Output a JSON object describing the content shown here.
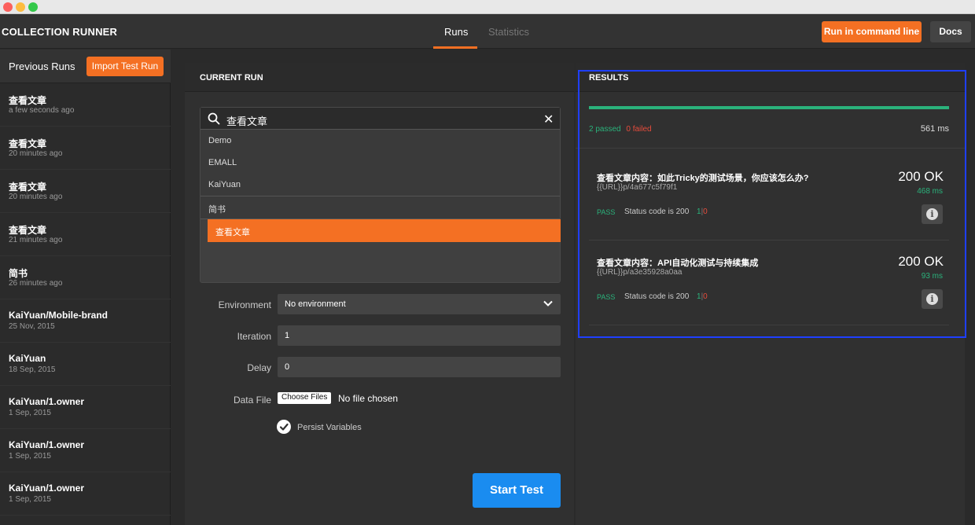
{
  "header": {
    "app_title": "COLLECTION RUNNER",
    "tabs": [
      {
        "label": "Runs"
      },
      {
        "label": "Statistics"
      }
    ],
    "run_cmd_label": "Run in command line",
    "docs_label": "Docs"
  },
  "sidebar": {
    "title": "Previous Runs",
    "import_label": "Import Test Run",
    "runs": [
      {
        "name": "查看文章",
        "time": "a few seconds ago"
      },
      {
        "name": "查看文章",
        "time": "20 minutes ago"
      },
      {
        "name": "查看文章",
        "time": "20 minutes ago"
      },
      {
        "name": "查看文章",
        "time": "21 minutes ago"
      },
      {
        "name": "简书",
        "time": "26 minutes ago"
      },
      {
        "name": "KaiYuan/Mobile-brand",
        "time": "25 Nov, 2015"
      },
      {
        "name": "KaiYuan",
        "time": "18 Sep, 2015"
      },
      {
        "name": "KaiYuan/1.owner",
        "time": "1 Sep, 2015"
      },
      {
        "name": "KaiYuan/1.owner",
        "time": "1 Sep, 2015"
      },
      {
        "name": "KaiYuan/1.owner",
        "time": "1 Sep, 2015"
      }
    ]
  },
  "current_run": {
    "title": "CURRENT RUN",
    "search_value": "查看文章",
    "options": [
      "Demo",
      "EMALL",
      "KaiYuan",
      "简书",
      "查看文章"
    ],
    "environment_label": "Environment",
    "environment_value": "No environment",
    "iteration_label": "Iteration",
    "iteration_value": "1",
    "delay_label": "Delay",
    "delay_value": "0",
    "datafile_label": "Data File",
    "choose_files_label": "Choose Files",
    "no_file_label": "No file chosen",
    "persist_label": "Persist Variables",
    "start_label": "Start Test"
  },
  "results": {
    "title": "RESULTS",
    "passed": "2 passed",
    "failed": "0 failed",
    "duration": "561 ms",
    "items": [
      {
        "title": "查看文章内容：如此Tricky的测试场景，你应该怎么办?",
        "url": "{{URL}}p/4a677c5f79f1",
        "status": "200 OK",
        "ms": "468 ms",
        "pass_label": "PASS",
        "test": "Status code is 200",
        "pass_count": "1",
        "sep": "|",
        "fail_count": "0"
      },
      {
        "title": "查看文章内容：API自动化测试与持续集成",
        "url": "{{URL}}p/a3e35928a0aa",
        "status": "200 OK",
        "ms": "93 ms",
        "pass_label": "PASS",
        "test": "Status code is 200",
        "pass_count": "1",
        "sep": "|",
        "fail_count": "0"
      }
    ]
  },
  "colors": {
    "accent": "#f47023",
    "primary_button": "#1a8cf0",
    "pass": "#2ab27b",
    "fail": "#e74c3c",
    "highlight_border": "#1f3fff"
  }
}
